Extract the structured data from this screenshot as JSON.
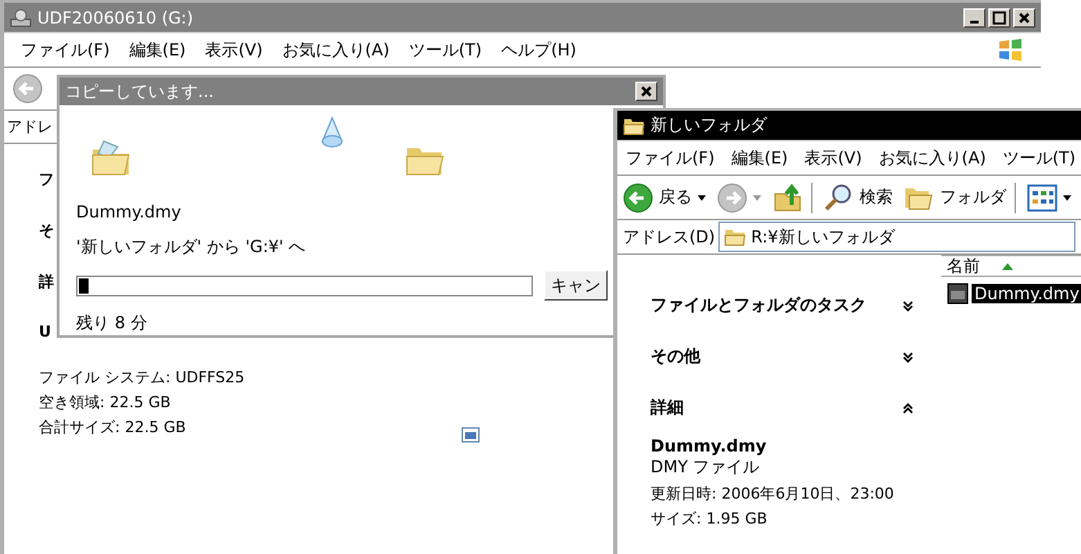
{
  "background_window": {
    "title": "UDF20060610 (G:)",
    "menu": [
      "ファイル(F)",
      "編集(E)",
      "表示(V)",
      "お気に入り(A)",
      "ツール(T)",
      "ヘルプ(H)"
    ],
    "address_label": "アドレ",
    "tasks": [
      "フ",
      "そ",
      "詳"
    ],
    "details": {
      "name": "U",
      "lines": [
        "ファイル システム: UDFFS25",
        "空き領域: 22.5 GB",
        "合計サイズ: 22.5 GB"
      ]
    }
  },
  "copy_dialog": {
    "title": "コピーしています...",
    "file": "Dummy.dmy",
    "from_to": "'新しいフォルダ' から 'G:¥' へ",
    "level": 0.02,
    "remaining": "残り 8 分",
    "cancel": "キャン"
  },
  "folder_window": {
    "title": "新しいフォルダ",
    "menu": [
      "ファイル(F)",
      "編集(E)",
      "表示(V)",
      "お気に入り(A)",
      "ツール(T)"
    ],
    "toolbar": [
      {
        "kind": "back",
        "label": "戻る"
      },
      {
        "kind": "forward"
      },
      {
        "kind": "up"
      },
      {
        "kind": "search",
        "label": "検索"
      },
      {
        "kind": "folders",
        "label": "フォルダ"
      },
      {
        "kind": "views"
      }
    ],
    "address_label": "アドレス(D)",
    "address": "R:¥新しいフォルダ",
    "tasks": [
      {
        "title": "ファイルとフォルダのタスク",
        "expanded": false
      },
      {
        "title": "その他",
        "expanded": false
      },
      {
        "title": "詳細",
        "expanded": true
      }
    ],
    "details": {
      "name": "Dummy.dmy",
      "type": "DMY ファイル",
      "lines": [
        "更新日時: 2006年6月10日、23:00",
        "サイズ: 1.95 GB"
      ]
    },
    "column": "名前",
    "files": [
      {
        "name": "Dummy.dmy",
        "selected": true
      }
    ]
  }
}
